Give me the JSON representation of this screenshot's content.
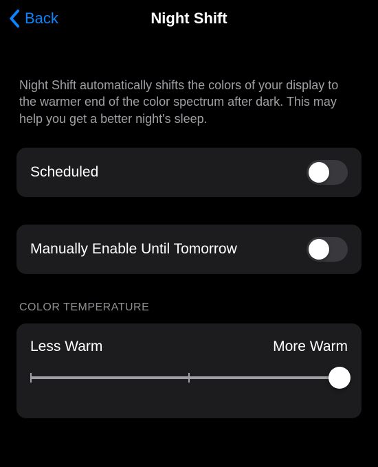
{
  "nav": {
    "back_label": "Back",
    "title": "Night Shift"
  },
  "description": "Night Shift automatically shifts the colors of your display to the warmer end of the color spectrum after dark. This may help you get a better night's sleep.",
  "settings": {
    "scheduled": {
      "label": "Scheduled",
      "enabled": false
    },
    "manual": {
      "label": "Manually Enable Until Tomorrow",
      "enabled": false
    }
  },
  "color_temperature": {
    "header": "COLOR TEMPERATURE",
    "min_label": "Less Warm",
    "max_label": "More Warm",
    "value": 100
  }
}
